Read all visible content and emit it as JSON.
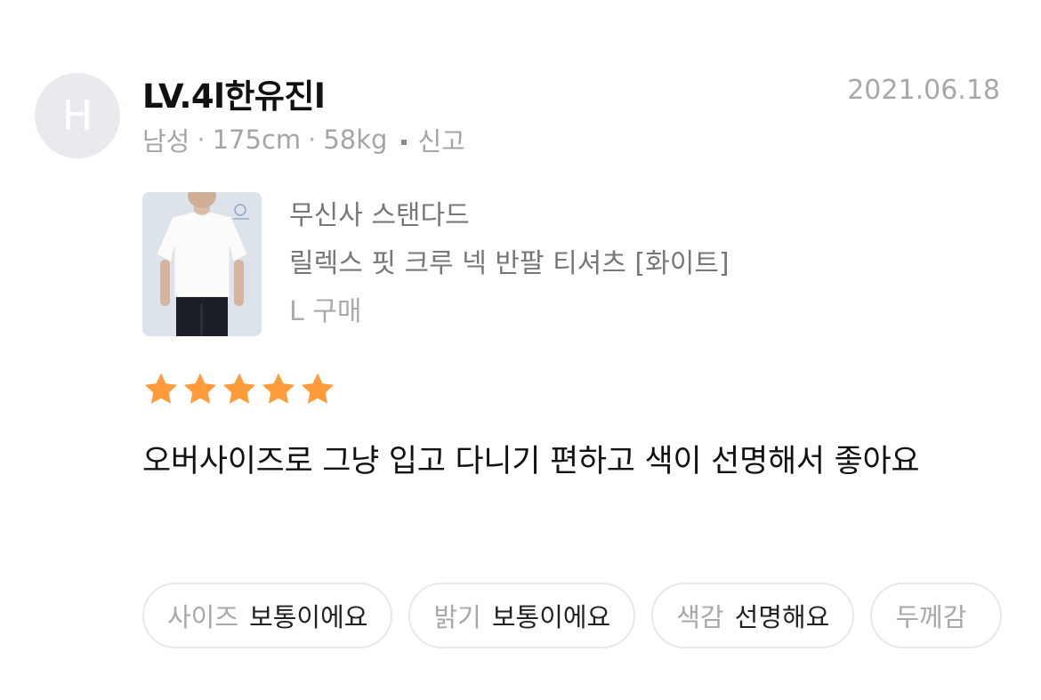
{
  "user": {
    "avatar_letter": "H",
    "name": "LV.4l한유진l",
    "gender": "남성",
    "height": "175cm",
    "weight": "58kg",
    "meta_separator": "·",
    "report_label": "신고",
    "date": "2021.06.18"
  },
  "product": {
    "brand": "무신사 스탠다드",
    "name": "릴렉스 핏 크루 넥 반팔 티셔츠 [화이트]",
    "option": "L  구매",
    "thumbnail_icon": "white-tshirt-model-photo"
  },
  "rating": {
    "value": 5,
    "max": 5,
    "star_color": "#ff9b38"
  },
  "review": {
    "text": "오버사이즈로 그냥 입고 다니기 편하고 색이 선명해서 좋아요"
  },
  "tags": [
    {
      "key": "사이즈",
      "value": "보통이에요"
    },
    {
      "key": "밝기",
      "value": "보통이에요"
    },
    {
      "key": "색감",
      "value": "선명해요"
    },
    {
      "key": "두께감",
      "value": ""
    }
  ]
}
